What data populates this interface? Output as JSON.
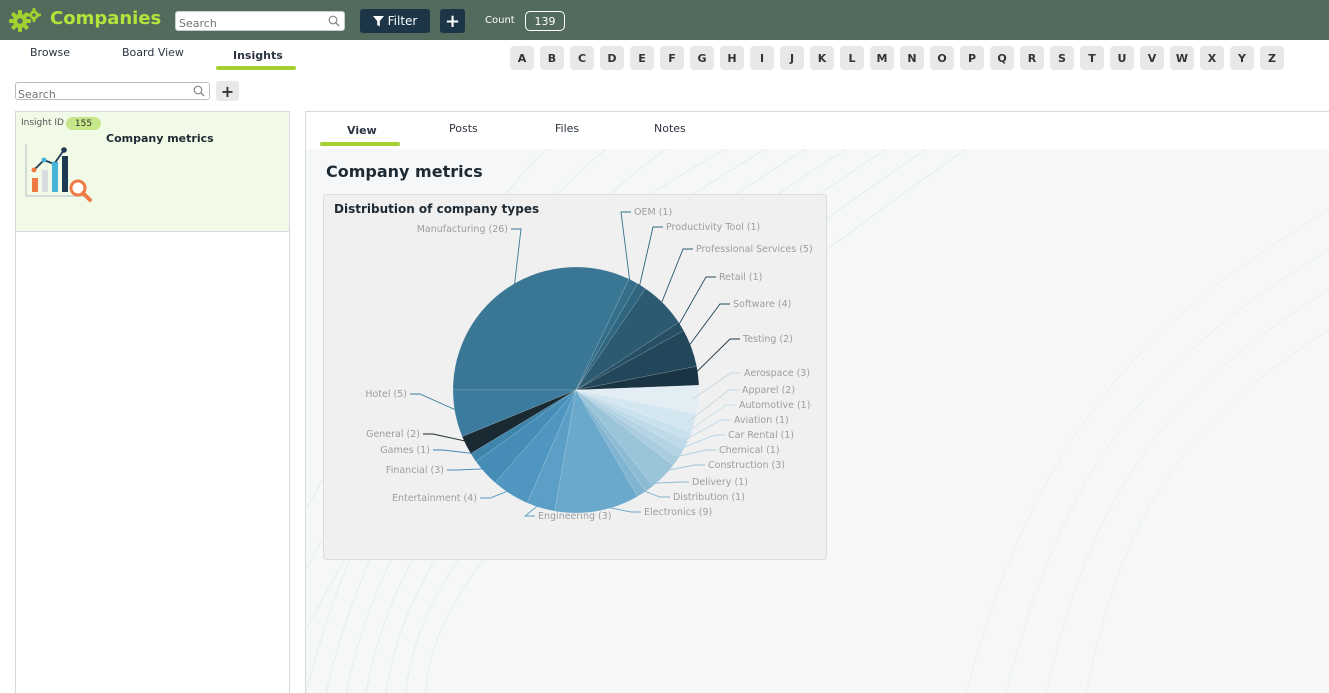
{
  "app": {
    "title": "Companies"
  },
  "topbar": {
    "search_placeholder": "Search",
    "filter_label": "Filter",
    "add_label": "+",
    "count_label": "Count",
    "count_value": "139"
  },
  "subnav": {
    "tabs": [
      {
        "label": "Browse"
      },
      {
        "label": "Board View"
      },
      {
        "label": "Insights"
      }
    ],
    "active_tab": "Insights"
  },
  "letters": [
    "A",
    "B",
    "C",
    "D",
    "E",
    "F",
    "G",
    "H",
    "I",
    "J",
    "K",
    "L",
    "M",
    "N",
    "O",
    "P",
    "Q",
    "R",
    "S",
    "T",
    "U",
    "V",
    "W",
    "X",
    "Y",
    "Z"
  ],
  "sidebar": {
    "search_placeholder": "Search",
    "add_label": "+",
    "cards": [
      {
        "id_label": "Insight ID",
        "id_value": "155",
        "title": "Company metrics"
      }
    ]
  },
  "detail": {
    "tabs": [
      {
        "label": "View"
      },
      {
        "label": "Posts"
      },
      {
        "label": "Files"
      },
      {
        "label": "Notes"
      }
    ],
    "active_tab": "View",
    "title": "Company metrics"
  },
  "colors": {
    "topbar_bg": "#526b5c",
    "brand_green": "#b6e33b",
    "accent_underline": "#a4d12f",
    "dark_button": "#1c3547",
    "card_bg": "#f1fae7"
  },
  "chart_data": {
    "type": "pie",
    "title": "Distribution of company types",
    "slices": [
      {
        "label": "Manufacturing (26)",
        "category": "Manufacturing",
        "value": 26,
        "color": "#3a7795"
      },
      {
        "label": "OEM (1)",
        "category": "OEM",
        "value": 1,
        "color": "#356e8a"
      },
      {
        "label": "Productivity Tool (1)",
        "category": "Productivity Tool",
        "value": 1,
        "color": "#30657f"
      },
      {
        "label": "Professional Services (5)",
        "category": "Professional Services",
        "value": 5,
        "color": "#2b5a71"
      },
      {
        "label": "Retail (1)",
        "category": "Retail",
        "value": 1,
        "color": "#274f64"
      },
      {
        "label": "Software (4)",
        "category": "Software",
        "value": 4,
        "color": "#22465a"
      },
      {
        "label": "Testing (2)",
        "category": "Testing",
        "value": 2,
        "color": "#1b3444"
      },
      {
        "label": "Aerospace (3)",
        "category": "Aerospace",
        "value": 3,
        "color": "#e2eef4"
      },
      {
        "label": "Apparel (2)",
        "category": "Apparel",
        "value": 2,
        "color": "#d4e7f0"
      },
      {
        "label": "Automotive (1)",
        "category": "Automotive",
        "value": 1,
        "color": "#c9e1ec"
      },
      {
        "label": "Aviation (1)",
        "category": "Aviation",
        "value": 1,
        "color": "#bfdae8"
      },
      {
        "label": "Car Rental (1)",
        "category": "Car Rental",
        "value": 1,
        "color": "#b4d4e4"
      },
      {
        "label": "Chemical (1)",
        "category": "Chemical",
        "value": 1,
        "color": "#a9cddf"
      },
      {
        "label": "Construction (3)",
        "category": "Construction",
        "value": 3,
        "color": "#9ac4da"
      },
      {
        "label": "Delivery (1)",
        "category": "Delivery",
        "value": 1,
        "color": "#8cbbd4"
      },
      {
        "label": "Distribution (1)",
        "category": "Distribution",
        "value": 1,
        "color": "#80b4d0"
      },
      {
        "label": "Electronics (9)",
        "category": "Electronics",
        "value": 9,
        "color": "#6aa9cc"
      },
      {
        "label": "Engineering (3)",
        "category": "Engineering",
        "value": 3,
        "color": "#5b9fc6"
      },
      {
        "label": "Entertainment (4)",
        "category": "Entertainment",
        "value": 4,
        "color": "#4f97c1"
      },
      {
        "label": "Financial (3)",
        "category": "Financial",
        "value": 3,
        "color": "#458cb6"
      },
      {
        "label": "Games (1)",
        "category": "Games",
        "value": 1,
        "color": "#3f84ab"
      },
      {
        "label": "General (2)",
        "category": "General",
        "value": 2,
        "color": "#1a2a33"
      },
      {
        "label": "Hotel (5)",
        "category": "Hotel",
        "value": 5,
        "color": "#3b7c9e"
      }
    ]
  }
}
